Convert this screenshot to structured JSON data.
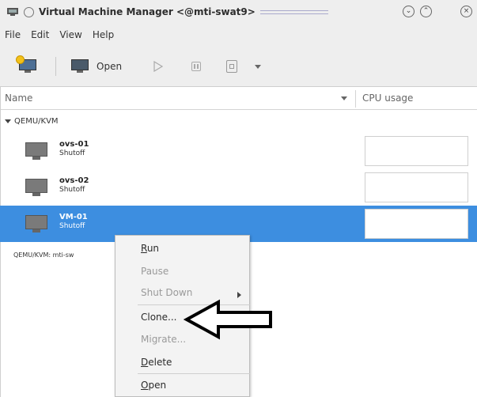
{
  "window": {
    "title": "Virtual Machine Manager <@mti-swat9>",
    "buttons": [
      "minimize",
      "maximize",
      "close"
    ]
  },
  "menubar": {
    "items": [
      "File",
      "Edit",
      "View",
      "Help"
    ]
  },
  "toolbar": {
    "open_label": "Open"
  },
  "columns": {
    "name": "Name",
    "cpu": "CPU usage"
  },
  "tree": {
    "group": "QEMU/KVM",
    "vms": [
      {
        "name": "ovs-01",
        "status": "Shutoff",
        "selected": false
      },
      {
        "name": "ovs-02",
        "status": "Shutoff",
        "selected": false
      },
      {
        "name": "VM-01",
        "status": "Shutoff",
        "selected": true
      }
    ],
    "connection_label": "QEMU/KVM: mti-sw"
  },
  "context_menu": {
    "run": "Run",
    "pause": "Pause",
    "shutdown": "Shut Down",
    "clone": "Clone...",
    "migrate": "Migrate...",
    "delete": "Delete",
    "open": "Open"
  },
  "colors": {
    "selection": "#3d8ee0",
    "chrome": "#eeeeee"
  }
}
